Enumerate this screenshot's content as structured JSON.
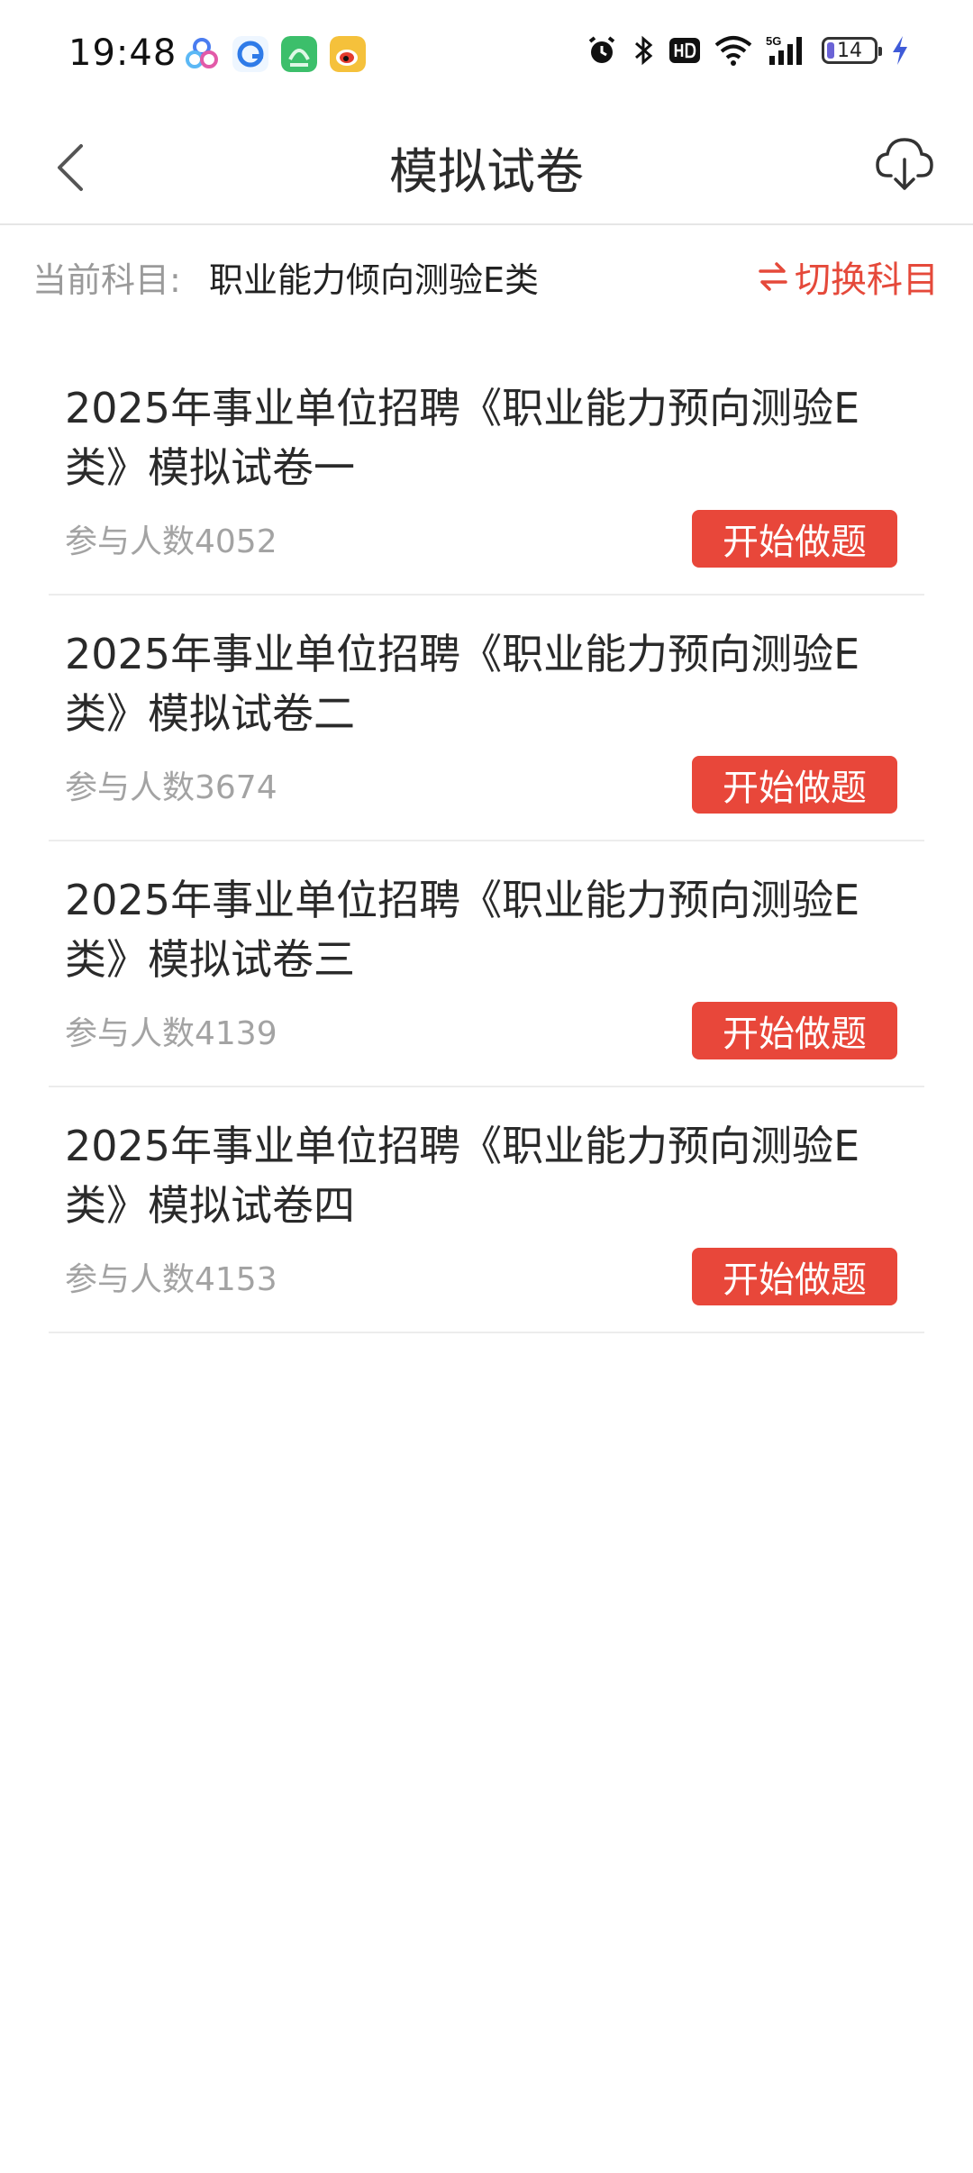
{
  "status_bar": {
    "time": "19:48",
    "battery_level": "14",
    "network": "5G"
  },
  "nav": {
    "title": "模拟试卷"
  },
  "subject": {
    "label": "当前科目:",
    "value": "职业能力倾向测验E类",
    "switch_label": "切换科目"
  },
  "exams": [
    {
      "title": "2025年事业单位招聘《职业能力预向测验E类》模拟试卷一",
      "count": "参与人数4052",
      "button": "开始做题"
    },
    {
      "title": "2025年事业单位招聘《职业能力预向测验E类》模拟试卷二",
      "count": "参与人数3674",
      "button": "开始做题"
    },
    {
      "title": "2025年事业单位招聘《职业能力预向测验E类》模拟试卷三",
      "count": "参与人数4139",
      "button": "开始做题"
    },
    {
      "title": "2025年事业单位招聘《职业能力预向测验E类》模拟试卷四",
      "count": "参与人数4153",
      "button": "开始做题"
    }
  ],
  "colors": {
    "accent": "#e8473a",
    "muted_text": "#a3a3a3",
    "title_text": "#2a2a2a"
  },
  "icons": {
    "back": "chevron-left-icon",
    "download": "cloud-download-icon",
    "switch": "swap-arrows-icon"
  }
}
